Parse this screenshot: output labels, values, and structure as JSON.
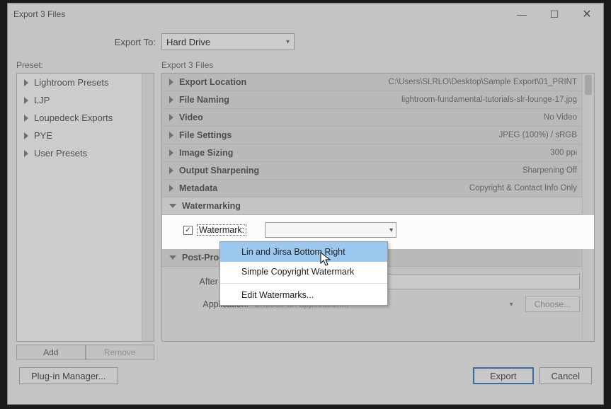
{
  "window": {
    "title": "Export 3 Files"
  },
  "export_to": {
    "label": "Export To:",
    "value": "Hard Drive"
  },
  "preset": {
    "header": "Preset:",
    "items": [
      "Lightroom Presets",
      "LJP",
      "Loupedeck Exports",
      "PYE",
      "User Presets"
    ],
    "add": "Add",
    "remove": "Remove"
  },
  "right_header": "Export 3 Files",
  "sections": {
    "export_location": {
      "title": "Export Location",
      "value": "C:\\Users\\SLRLO\\Desktop\\Sample Export\\01_PRINT"
    },
    "file_naming": {
      "title": "File Naming",
      "value": "lightroom-fundamental-tutorials-slr-lounge-17.jpg"
    },
    "video": {
      "title": "Video",
      "value": "No Video"
    },
    "file_settings": {
      "title": "File Settings",
      "value": "JPEG (100%) / sRGB"
    },
    "image_sizing": {
      "title": "Image Sizing",
      "value": "300 ppi"
    },
    "output_sharpening": {
      "title": "Output Sharpening",
      "value": "Sharpening Off"
    },
    "metadata": {
      "title": "Metadata",
      "value": "Copyright & Contact Info Only"
    },
    "watermarking": {
      "title": "Watermarking"
    },
    "post_process": {
      "title": "Post-Processing"
    }
  },
  "watermark": {
    "checkbox_label": "Watermark:"
  },
  "dropdown": {
    "items": [
      "Lin and Jirsa Bottom Right",
      "Simple Copyright Watermark",
      "Edit Watermarks..."
    ]
  },
  "postprocess": {
    "after_label": "After Export:",
    "app_label": "Application:",
    "app_placeholder": "Choose an application...",
    "choose": "Choose..."
  },
  "buttons": {
    "plugin": "Plug-in Manager...",
    "export": "Export",
    "cancel": "Cancel"
  }
}
